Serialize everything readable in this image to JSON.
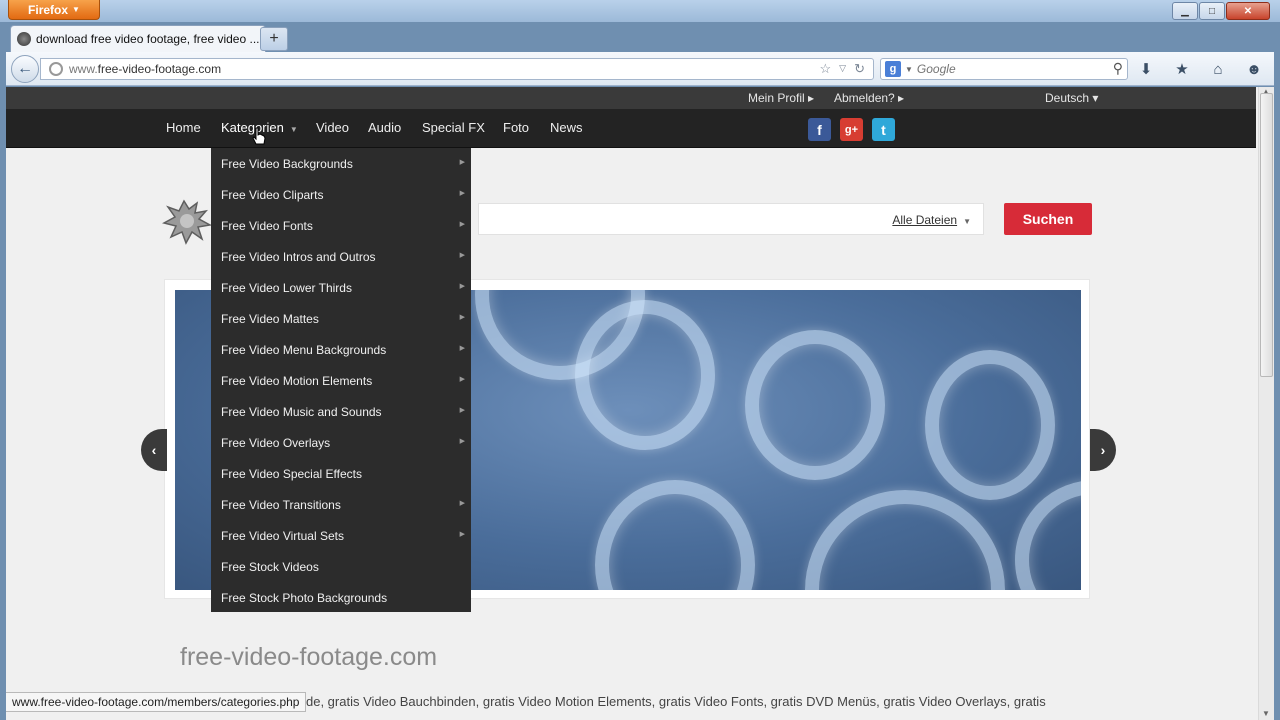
{
  "browser": {
    "app_button": "Firefox",
    "tab_title": "download free video footage, free video ...",
    "new_tab_label": "+",
    "url_prefix": "www.",
    "url_domain": "free-video-footage.com",
    "search_placeholder": "Google",
    "search_engine_letter": "g",
    "status_url": "www.free-video-footage.com/members/categories.php"
  },
  "page": {
    "topbar": {
      "profile": "Mein Profil ▸",
      "logout": "Abmelden? ▸",
      "language": "Deutsch ▾"
    },
    "nav": [
      "Home",
      "Kategorien",
      "Video",
      "Audio",
      "Special FX",
      "Foto",
      "News"
    ],
    "social": {
      "facebook": "f",
      "googleplus": "g+",
      "twitter": "t"
    },
    "search": {
      "scope": "Alle Dateien",
      "button": "Suchen"
    },
    "dropdown": [
      {
        "label": "Free Video Backgrounds",
        "sub": true
      },
      {
        "label": "Free Video Cliparts",
        "sub": true
      },
      {
        "label": "Free Video Fonts",
        "sub": true
      },
      {
        "label": "Free Video Intros and Outros",
        "sub": true
      },
      {
        "label": "Free Video Lower Thirds",
        "sub": true
      },
      {
        "label": "Free Video Mattes",
        "sub": true
      },
      {
        "label": "Free Video Menu Backgrounds",
        "sub": true
      },
      {
        "label": "Free Video Motion Elements",
        "sub": true
      },
      {
        "label": "Free Video Music and Sounds",
        "sub": true
      },
      {
        "label": "Free Video Overlays",
        "sub": true
      },
      {
        "label": "Free Video Special Effects",
        "sub": false
      },
      {
        "label": "Free Video Transitions",
        "sub": true
      },
      {
        "label": "Free Video Virtual Sets",
        "sub": true
      },
      {
        "label": "Free Stock Videos",
        "sub": false
      },
      {
        "label": "Free Stock Photo Backgrounds",
        "sub": false
      }
    ],
    "site_title": "free-video-footage.com",
    "tags_line": "de, gratis Video Bauchbinden, gratis Video Motion Elements, gratis Video Fonts, gratis DVD Menüs, gratis Video Overlays, gratis"
  },
  "colors": {
    "accent": "#d72b38",
    "nav_bg": "#232323",
    "dropdown_bg": "#2c2c2c"
  }
}
